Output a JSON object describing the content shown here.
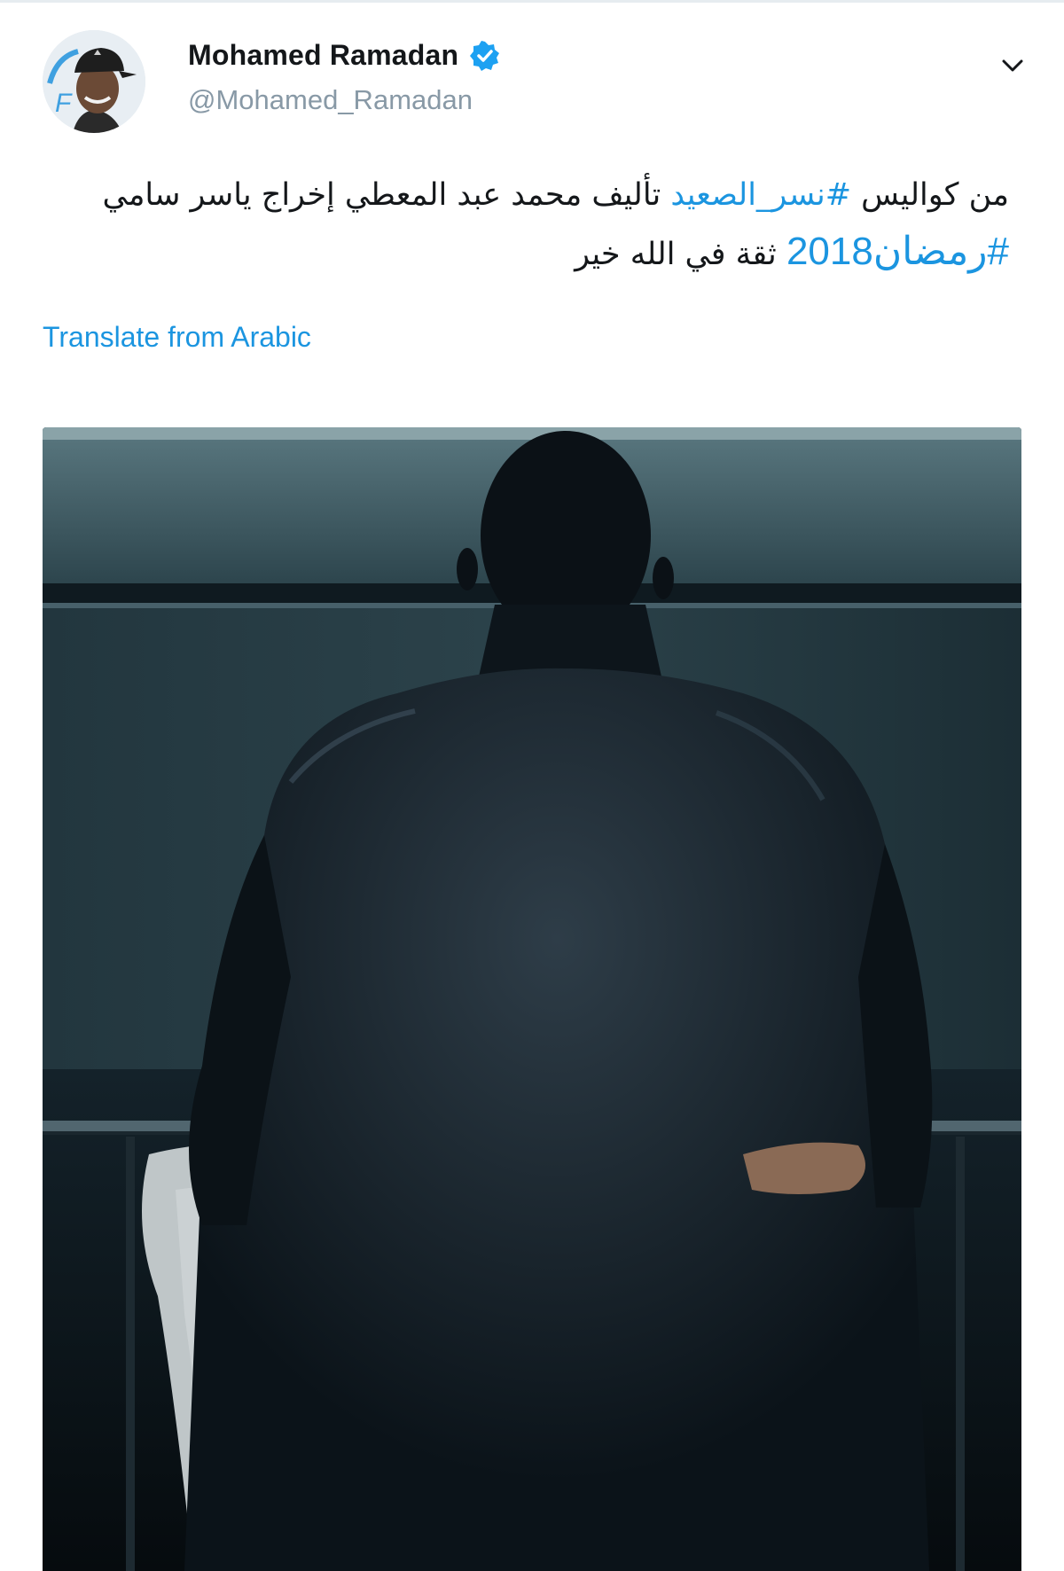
{
  "tweet": {
    "author": {
      "display_name": "Mohamed Ramadan",
      "handle": "@Mohamed_Ramadan",
      "verified": true
    },
    "text": {
      "line1_start": "من كواليس ",
      "hashtag1": "#نسر_الصعيد",
      "line1_end": " تأليف محمد عبد المعطي إخراج ياسر سامي",
      "hashtag2": "#رمضان2018",
      "line2_end": " ثقة في الله خير"
    },
    "translate_label": "Translate from Arabic"
  },
  "colors": {
    "link": "#1b95e0",
    "text": "#14171a",
    "muted": "#8899a6"
  },
  "icons": {
    "verified": "verified-badge-icon",
    "menu": "chevron-down-icon"
  }
}
